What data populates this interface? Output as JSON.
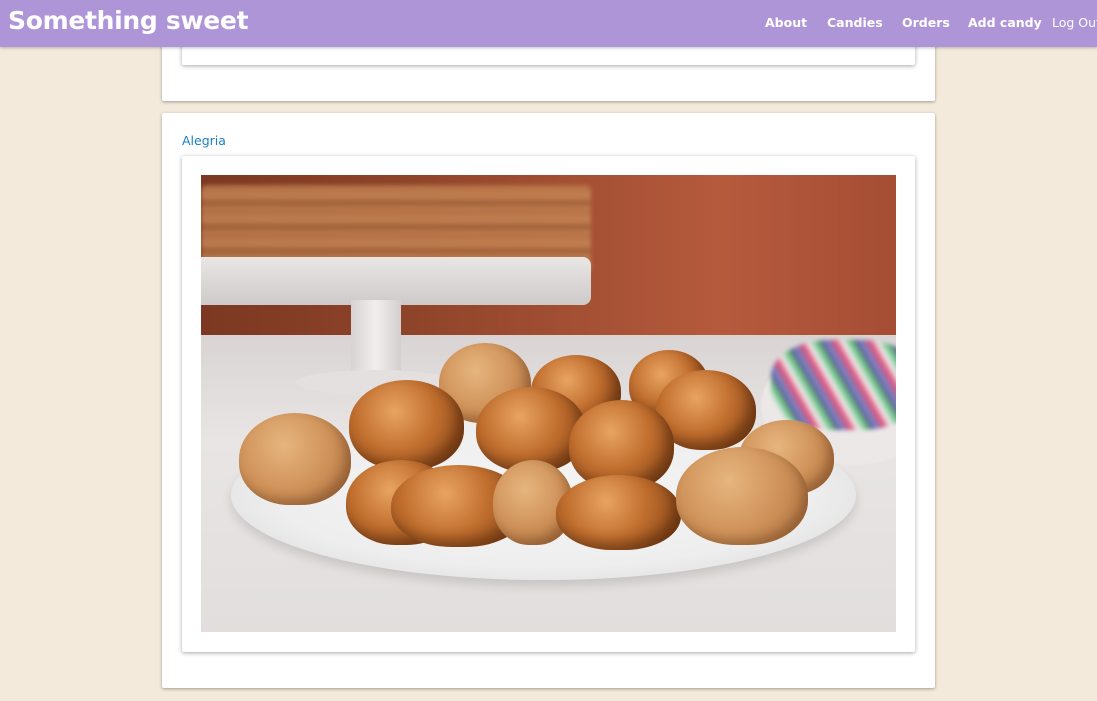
{
  "navbar": {
    "brand": "Something sweet",
    "links": {
      "about": "About",
      "candies": "Candies",
      "orders": "Orders",
      "add_candy": "Add candy",
      "log_out": "Log Out"
    },
    "background_color": "#ae95d8"
  },
  "page": {
    "background_color": "#f4eadc"
  },
  "candy_card": {
    "title": "Alegria",
    "title_color": "#1a7fc4",
    "image_description": "alegria-candy-photo"
  }
}
